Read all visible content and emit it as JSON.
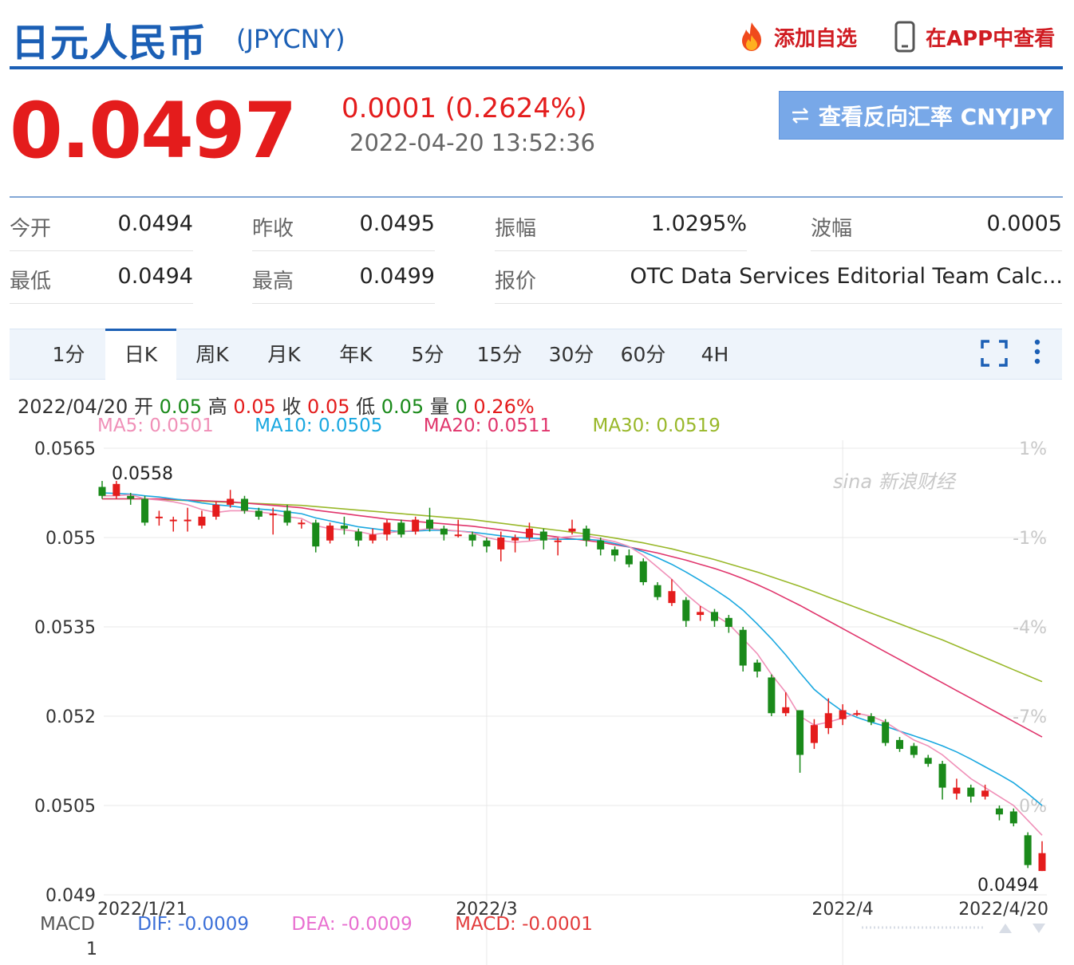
{
  "header": {
    "title": "日元人民币",
    "code": "(JPYCNY)",
    "add_favorite": "添加自选",
    "view_in_app": "在APP中查看"
  },
  "quote": {
    "price": "0.0497",
    "change": "0.0001 (0.2624%)",
    "timestamp": "2022-04-20 13:52:36",
    "reverse_button": "查看反向汇率 CNYJPY"
  },
  "stats": [
    {
      "label": "今开",
      "value": "0.0494"
    },
    {
      "label": "昨收",
      "value": "0.0495"
    },
    {
      "label": "振幅",
      "value": "1.0295%"
    },
    {
      "label": "波幅",
      "value": "0.0005"
    },
    {
      "label": "最低",
      "value": "0.0494"
    },
    {
      "label": "最高",
      "value": "0.0499"
    },
    {
      "label": "报价",
      "value": "OTC Data Services Editorial Team Calc..."
    }
  ],
  "tabs": [
    "1分",
    "日K",
    "周K",
    "月K",
    "年K",
    "5分",
    "15分",
    "30分",
    "60分",
    "4H"
  ],
  "active_tab": "日K",
  "ohlc_line": {
    "date": "2022/04/20",
    "open_label": "开",
    "open": "0.05",
    "high_label": "高",
    "high": "0.05",
    "close_label": "收",
    "close": "0.05",
    "low_label": "低",
    "low": "0.05",
    "vol_label": "量",
    "vol": "0",
    "pct": "0.26%"
  },
  "ma_line": {
    "ma5": "MA5: 0.0501",
    "ma10": "MA10: 0.0505",
    "ma20": "MA20: 0.0511",
    "ma30": "MA30: 0.0519"
  },
  "macd_line": {
    "label": "MACD",
    "dif": "DIF: -0.0009",
    "dea": "DEA: -0.0009",
    "macd": "MACD: -0.0001",
    "sub_tick": "1"
  },
  "watermark": "sina 新浪财经",
  "colors": {
    "brand_blue": "#1b5fb5",
    "up": "#e41c1c",
    "down": "#1a8a1a",
    "ma5": "#f090b8",
    "ma10": "#1aa8e0",
    "ma20": "#e0356c",
    "ma30": "#99b82a",
    "dif": "#3b6fd8",
    "dea": "#e86fd0",
    "macd": "#e23b3b"
  },
  "chart_data": {
    "type": "candlestick",
    "ylim": [
      0.049,
      0.0565
    ],
    "y_ticks": [
      "0.0565",
      "0.055",
      "0.0535",
      "0.052",
      "0.0505",
      "0.049"
    ],
    "right_ticks": [
      "1%",
      "-1%",
      "-4%",
      "-7%",
      "0%"
    ],
    "x_ticks": [
      "2022/1/21",
      "2022/3",
      "2022/4",
      "2022/4/20"
    ],
    "x_tick_index": [
      0,
      27,
      52,
      66
    ],
    "max_label": "0.0558",
    "min_label": "0.0494",
    "candles": [
      [
        0.05585,
        0.0557,
        0.05595,
        0.05565
      ],
      [
        0.0557,
        0.0559,
        0.05595,
        0.05565
      ],
      [
        0.0557,
        0.05565,
        0.05575,
        0.05555
      ],
      [
        0.05565,
        0.05525,
        0.0557,
        0.0552
      ],
      [
        0.05535,
        0.05535,
        0.05545,
        0.0552
      ],
      [
        0.0553,
        0.0553,
        0.05535,
        0.0551
      ],
      [
        0.0553,
        0.0553,
        0.0555,
        0.0551
      ],
      [
        0.0552,
        0.05535,
        0.05545,
        0.05515
      ],
      [
        0.05535,
        0.05555,
        0.0556,
        0.0553
      ],
      [
        0.05555,
        0.05565,
        0.0558,
        0.0555
      ],
      [
        0.05565,
        0.05545,
        0.0557,
        0.0554
      ],
      [
        0.05545,
        0.05535,
        0.0555,
        0.0553
      ],
      [
        0.0554,
        0.0554,
        0.0555,
        0.05505
      ],
      [
        0.05545,
        0.05525,
        0.05555,
        0.0552
      ],
      [
        0.05525,
        0.05525,
        0.0553,
        0.05515
      ],
      [
        0.05525,
        0.05485,
        0.0553,
        0.05475
      ],
      [
        0.05495,
        0.0552,
        0.05525,
        0.0549
      ],
      [
        0.0552,
        0.05515,
        0.05535,
        0.05505
      ],
      [
        0.0551,
        0.05495,
        0.05515,
        0.05485
      ],
      [
        0.05495,
        0.05505,
        0.05515,
        0.0549
      ],
      [
        0.05505,
        0.05525,
        0.0553,
        0.05495
      ],
      [
        0.05525,
        0.05505,
        0.0553,
        0.055
      ],
      [
        0.0551,
        0.0553,
        0.05535,
        0.05505
      ],
      [
        0.0553,
        0.05515,
        0.0555,
        0.0551
      ],
      [
        0.05515,
        0.05505,
        0.0552,
        0.05495
      ],
      [
        0.05505,
        0.05505,
        0.0553,
        0.055
      ],
      [
        0.05505,
        0.05495,
        0.0551,
        0.05485
      ],
      [
        0.05495,
        0.05485,
        0.055,
        0.05475
      ],
      [
        0.0548,
        0.055,
        0.0551,
        0.0546
      ],
      [
        0.05495,
        0.055,
        0.05505,
        0.05475
      ],
      [
        0.055,
        0.05515,
        0.05525,
        0.05495
      ],
      [
        0.0551,
        0.05495,
        0.05515,
        0.0548
      ],
      [
        0.05495,
        0.05495,
        0.055,
        0.0547
      ],
      [
        0.0551,
        0.05515,
        0.0553,
        0.05505
      ],
      [
        0.05515,
        0.05495,
        0.0552,
        0.05485
      ],
      [
        0.05495,
        0.0548,
        0.055,
        0.0547
      ],
      [
        0.0548,
        0.0547,
        0.05485,
        0.0546
      ],
      [
        0.0547,
        0.05455,
        0.0548,
        0.0545
      ],
      [
        0.0546,
        0.05425,
        0.05465,
        0.0542
      ],
      [
        0.0542,
        0.054,
        0.05425,
        0.05395
      ],
      [
        0.0539,
        0.0541,
        0.0543,
        0.05385
      ],
      [
        0.05395,
        0.0536,
        0.054,
        0.0535
      ],
      [
        0.0537,
        0.05375,
        0.05385,
        0.0536
      ],
      [
        0.05375,
        0.0536,
        0.0538,
        0.0535
      ],
      [
        0.05365,
        0.0535,
        0.0537,
        0.0534
      ],
      [
        0.05345,
        0.05285,
        0.0535,
        0.05275
      ],
      [
        0.0529,
        0.05275,
        0.05295,
        0.05265
      ],
      [
        0.05265,
        0.05205,
        0.0527,
        0.052
      ],
      [
        0.05205,
        0.05215,
        0.0524,
        0.052
      ],
      [
        0.0521,
        0.05135,
        0.0521,
        0.05105
      ],
      [
        0.05155,
        0.05185,
        0.05195,
        0.05145
      ],
      [
        0.0518,
        0.05205,
        0.0523,
        0.0517
      ],
      [
        0.05195,
        0.0521,
        0.0522,
        0.05185
      ],
      [
        0.05205,
        0.05205,
        0.0521,
        0.052
      ],
      [
        0.052,
        0.0519,
        0.05205,
        0.05185
      ],
      [
        0.0519,
        0.05155,
        0.05195,
        0.0515
      ],
      [
        0.0516,
        0.05145,
        0.05165,
        0.0514
      ],
      [
        0.0515,
        0.05135,
        0.05155,
        0.0513
      ],
      [
        0.0513,
        0.0512,
        0.05135,
        0.05115
      ],
      [
        0.0512,
        0.0508,
        0.05125,
        0.0506
      ],
      [
        0.0507,
        0.0508,
        0.05095,
        0.0506
      ],
      [
        0.0508,
        0.05065,
        0.05085,
        0.05055
      ],
      [
        0.05065,
        0.05075,
        0.05085,
        0.0506
      ],
      [
        0.05045,
        0.05035,
        0.0505,
        0.05025
      ],
      [
        0.0504,
        0.0502,
        0.05045,
        0.05015
      ],
      [
        0.05,
        0.0495,
        0.05005,
        0.04945
      ],
      [
        0.0494,
        0.0497,
        0.0499,
        0.0494
      ]
    ],
    "ma5": [
      0.0557,
      0.0557,
      0.05572,
      0.05565,
      0.05563,
      0.0556,
      0.05555,
      0.05547,
      0.05542,
      0.05545,
      0.05545,
      0.05543,
      0.0554,
      0.05535,
      0.05532,
      0.0552,
      0.05515,
      0.05513,
      0.0551,
      0.05505,
      0.05508,
      0.0551,
      0.05512,
      0.05515,
      0.05513,
      0.05511,
      0.05508,
      0.055,
      0.05495,
      0.05492,
      0.05494,
      0.05497,
      0.055,
      0.05502,
      0.05503,
      0.05498,
      0.05493,
      0.05485,
      0.0547,
      0.0545,
      0.0543,
      0.05405,
      0.05385,
      0.0537,
      0.05355,
      0.0533,
      0.05305,
      0.0527,
      0.0524,
      0.052,
      0.05185,
      0.0519,
      0.05197,
      0.05205,
      0.052,
      0.0519,
      0.05175,
      0.0516,
      0.0515,
      0.05135,
      0.05115,
      0.05095,
      0.0508,
      0.05065,
      0.0505,
      0.05025,
      0.05
    ],
    "ma10": [
      0.05575,
      0.05574,
      0.05573,
      0.0557,
      0.05568,
      0.05565,
      0.05562,
      0.05558,
      0.05555,
      0.05553,
      0.0555,
      0.05548,
      0.05546,
      0.05543,
      0.0554,
      0.05533,
      0.05528,
      0.05523,
      0.05518,
      0.05515,
      0.05512,
      0.0551,
      0.05511,
      0.05512,
      0.05512,
      0.05511,
      0.05509,
      0.05506,
      0.05503,
      0.055,
      0.05499,
      0.05498,
      0.05497,
      0.05497,
      0.05497,
      0.05495,
      0.0549,
      0.05484,
      0.05476,
      0.05466,
      0.05455,
      0.05442,
      0.05428,
      0.05413,
      0.05397,
      0.05378,
      0.05355,
      0.0533,
      0.05303,
      0.05273,
      0.05245,
      0.05225,
      0.05208,
      0.05198,
      0.0519,
      0.05183,
      0.05175,
      0.05167,
      0.05159,
      0.0515,
      0.0514,
      0.05128,
      0.05115,
      0.05102,
      0.05088,
      0.0507,
      0.0505
    ],
    "ma20": [
      0.05565,
      0.05565,
      0.05565,
      0.05565,
      0.05565,
      0.05564,
      0.05563,
      0.05562,
      0.05561,
      0.0556,
      0.05558,
      0.05556,
      0.05554,
      0.05552,
      0.0555,
      0.05546,
      0.05543,
      0.0554,
      0.05537,
      0.05534,
      0.05531,
      0.05529,
      0.05527,
      0.05525,
      0.05523,
      0.05521,
      0.05519,
      0.05516,
      0.05513,
      0.0551,
      0.05507,
      0.05504,
      0.05501,
      0.05498,
      0.05495,
      0.05492,
      0.05488,
      0.05484,
      0.05479,
      0.05474,
      0.05468,
      0.05462,
      0.05455,
      0.05448,
      0.0544,
      0.05431,
      0.05421,
      0.0541,
      0.05398,
      0.05386,
      0.05373,
      0.0536,
      0.05347,
      0.05334,
      0.05321,
      0.05308,
      0.05295,
      0.05282,
      0.05269,
      0.05256,
      0.05243,
      0.0523,
      0.05217,
      0.05204,
      0.05191,
      0.05178,
      0.05165
    ],
    "ma30": [
      0.05565,
      0.05565,
      0.05565,
      0.05565,
      0.05564,
      0.05563,
      0.05562,
      0.05561,
      0.0556,
      0.05559,
      0.05558,
      0.05557,
      0.05556,
      0.05555,
      0.05554,
      0.05552,
      0.0555,
      0.05548,
      0.05546,
      0.05544,
      0.05542,
      0.0554,
      0.05538,
      0.05536,
      0.05534,
      0.05532,
      0.0553,
      0.05527,
      0.05524,
      0.05521,
      0.05518,
      0.05515,
      0.05512,
      0.05509,
      0.05506,
      0.05503,
      0.05499,
      0.05495,
      0.05491,
      0.05486,
      0.05481,
      0.05475,
      0.05469,
      0.05463,
      0.05456,
      0.05449,
      0.05442,
      0.05434,
      0.05426,
      0.05418,
      0.05409,
      0.054,
      0.05391,
      0.05382,
      0.05373,
      0.05364,
      0.05355,
      0.05346,
      0.05337,
      0.05328,
      0.05318,
      0.05308,
      0.05298,
      0.05288,
      0.05278,
      0.05268,
      0.05258
    ]
  }
}
